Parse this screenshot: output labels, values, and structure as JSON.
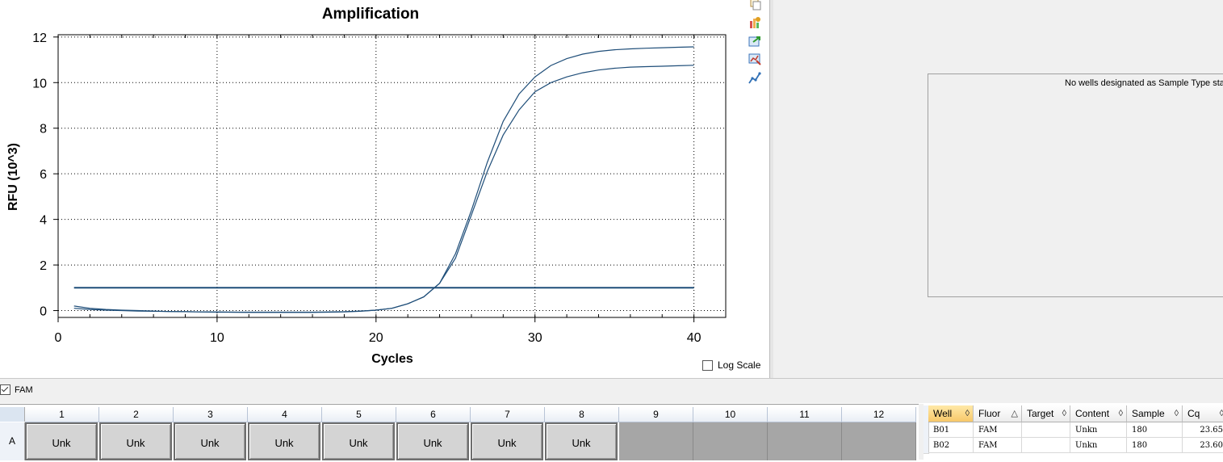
{
  "chart_data": {
    "type": "line",
    "title": "Amplification",
    "xlabel": "Cycles",
    "ylabel": "RFU (10^3)",
    "xlim": [
      0,
      42
    ],
    "ylim": [
      -0.3,
      12.1
    ],
    "xticks": [
      0,
      10,
      20,
      30,
      40
    ],
    "yticks": [
      0,
      2,
      4,
      6,
      8,
      10,
      12
    ],
    "grid": true,
    "x": [
      1,
      2,
      3,
      4,
      5,
      6,
      7,
      8,
      9,
      10,
      11,
      12,
      13,
      14,
      15,
      16,
      17,
      18,
      19,
      20,
      21,
      22,
      23,
      24,
      25,
      26,
      27,
      28,
      29,
      30,
      31,
      32,
      33,
      34,
      35,
      36,
      37,
      38,
      39,
      40
    ],
    "series": [
      {
        "values": [
          0.2,
          0.1,
          0.05,
          0.02,
          0.0,
          -0.02,
          -0.04,
          -0.05,
          -0.06,
          -0.07,
          -0.07,
          -0.08,
          -0.08,
          -0.08,
          -0.08,
          -0.08,
          -0.07,
          -0.06,
          -0.03,
          0.02,
          0.1,
          0.3,
          0.6,
          1.2,
          2.5,
          4.4,
          6.5,
          8.3,
          9.5,
          10.25,
          10.75,
          11.05,
          11.25,
          11.37,
          11.44,
          11.48,
          11.51,
          11.53,
          11.55,
          11.57
        ]
      },
      {
        "values": [
          0.1,
          0.05,
          0.02,
          0.0,
          -0.02,
          -0.03,
          -0.04,
          -0.05,
          -0.06,
          -0.06,
          -0.07,
          -0.07,
          -0.07,
          -0.07,
          -0.07,
          -0.07,
          -0.06,
          -0.05,
          -0.02,
          0.02,
          0.1,
          0.3,
          0.6,
          1.2,
          2.3,
          4.2,
          6.1,
          7.7,
          8.8,
          9.6,
          10.0,
          10.25,
          10.43,
          10.55,
          10.63,
          10.68,
          10.7,
          10.72,
          10.74,
          10.76
        ]
      }
    ],
    "threshold": 1.0,
    "line_color": "#1f4e79"
  },
  "log_scale": {
    "label": "Log Scale",
    "checked": false
  },
  "toolbar_icons": [
    "copy-icon",
    "chart-settings-icon",
    "export-icon",
    "zoom-icon",
    "curve-icon"
  ],
  "standard_curve": {
    "message": "No wells designated as Sample Type standard"
  },
  "fluor": {
    "label": "FAM",
    "checked": true
  },
  "plate": {
    "columns": [
      "1",
      "2",
      "3",
      "4",
      "5",
      "6",
      "7",
      "8",
      "9",
      "10",
      "11",
      "12"
    ],
    "row_label": "A",
    "wells": [
      "Unk",
      "Unk",
      "Unk",
      "Unk",
      "Unk",
      "Unk",
      "Unk",
      "Unk",
      "",
      "",
      "",
      ""
    ]
  },
  "well_table": {
    "headers": [
      "Well",
      "Fluor",
      "Target",
      "Content",
      "Sample",
      "Cq"
    ],
    "sort_glyphs": [
      "◊",
      "△",
      "◊",
      "◊",
      "◊",
      "◊"
    ],
    "rows": [
      [
        "B01",
        "FAM",
        "",
        "Unkn",
        "180",
        "23.65"
      ],
      [
        "B02",
        "FAM",
        "",
        "Unkn",
        "180",
        "23.60"
      ]
    ]
  }
}
